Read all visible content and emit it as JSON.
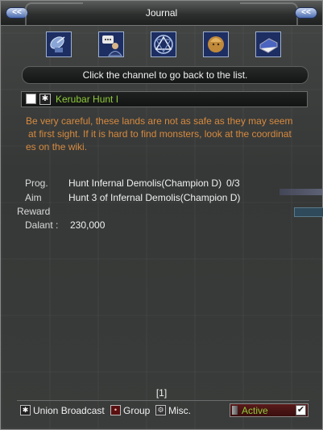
{
  "window": {
    "title": "Journal"
  },
  "titlebar_buttons": {
    "left": "<<",
    "right": "<<"
  },
  "channels": [
    {
      "icon": "satellite-dish-icon"
    },
    {
      "icon": "chat-person-icon"
    },
    {
      "icon": "triangle-emblem-icon"
    },
    {
      "icon": "gold-head-icon"
    },
    {
      "icon": "book-icon"
    }
  ],
  "notice": "Click the channel to go back to the list.",
  "quest": {
    "title": "Kerubar Hunt I",
    "description_lines": [
      "Be very careful, these lands are not as safe as they may seem",
      "at first sight. If it is hard to find monsters, look at the coordinat",
      "es on the wiki."
    ],
    "prog_label": "Prog.",
    "prog_value": "Hunt Infernal Demolis(Champion D)",
    "prog_count": "0/3",
    "aim_label": "Aim",
    "aim_value": "Hunt 3 of Infernal Demolis(Champion D)",
    "reward_label": "Reward",
    "dalant_label": "Dalant :",
    "dalant_value": "230,000"
  },
  "page_indicator": "[1]",
  "filters": {
    "union": "Union Broadcast",
    "group": "Group",
    "misc": "Misc."
  },
  "status": {
    "label": "Active",
    "checked": true
  },
  "colors": {
    "quest_title": "#8fcc3a",
    "description": "#d78a3e",
    "status_label": "#8fcc3a",
    "channel_border": "#9fb1cc"
  }
}
